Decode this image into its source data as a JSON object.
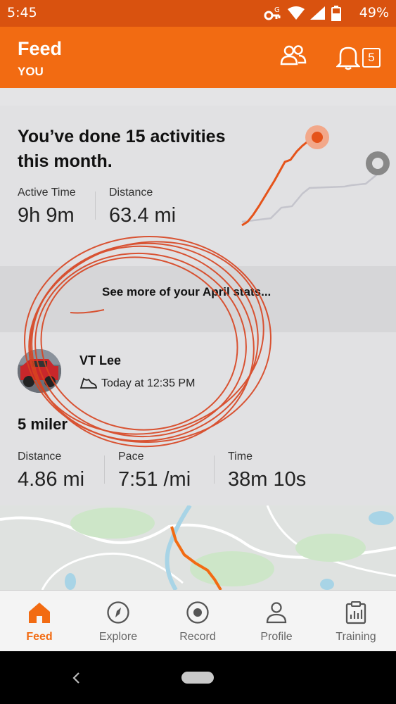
{
  "status": {
    "time": "5:45",
    "battery": "49%"
  },
  "header": {
    "title": "Feed",
    "subtitle": "YOU",
    "notification_count": "5"
  },
  "monthly": {
    "headline": "You’ve done 15 activities this month.",
    "active_time_label": "Active Time",
    "active_time_value": "9h 9m",
    "distance_label": "Distance",
    "distance_value": "63.4 mi",
    "see_more": "See more of your April stats..."
  },
  "activity": {
    "athlete": "VT Lee",
    "timestamp": "Today at 12:35 PM",
    "title": "5 miler",
    "stats": [
      {
        "label": "Distance",
        "value": "4.86 mi"
      },
      {
        "label": "Pace",
        "value": "7:51 /mi"
      },
      {
        "label": "Time",
        "value": "38m 10s"
      }
    ]
  },
  "tabs": [
    {
      "label": "Feed",
      "icon": "home-icon",
      "active": true
    },
    {
      "label": "Explore",
      "icon": "compass-icon",
      "active": false
    },
    {
      "label": "Record",
      "icon": "record-icon",
      "active": false
    },
    {
      "label": "Profile",
      "icon": "profile-icon",
      "active": false
    },
    {
      "label": "Training",
      "icon": "training-icon",
      "active": false
    }
  ],
  "colors": {
    "accent": "#f26b12",
    "status_bar": "#d9520f",
    "annotation": "#d8431f"
  }
}
